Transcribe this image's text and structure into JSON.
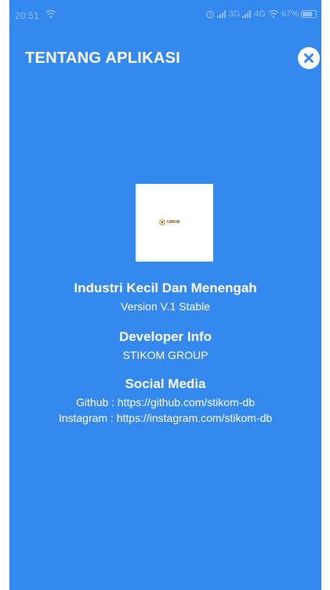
{
  "status_bar": {
    "time": "20:51",
    "network_1": "3G",
    "network_2": "4G",
    "battery": "67%"
  },
  "header": {
    "title": "TENTANG APLIKASI",
    "close_icon": "close-circle-icon"
  },
  "app_info": {
    "logo_text": "UMKM",
    "name": "Industri Kecil Dan Menengah",
    "version": "Version V.1 Stable"
  },
  "developer": {
    "heading": "Developer Info",
    "name": "STIKOM GROUP"
  },
  "social": {
    "heading": "Social Media",
    "github": "Github : https://github.com/stikom-db",
    "instagram": "Instagram : https://instagram.com/stikom-db"
  },
  "colors": {
    "background": "#3488ee",
    "text": "#ffffff"
  }
}
